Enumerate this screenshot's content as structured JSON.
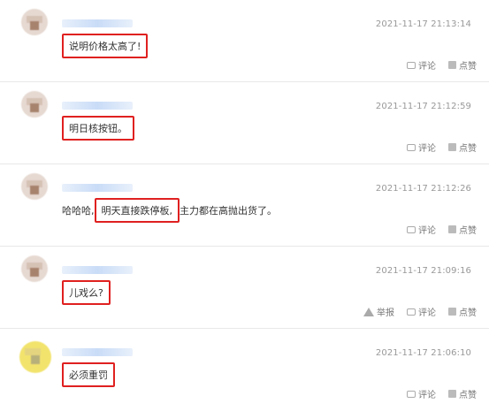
{
  "comments": [
    {
      "timestamp": "2021-11-17 21:13:14",
      "text_before": "",
      "highlight": "说明价格太高了!",
      "text_after": "",
      "comment_label": "评论",
      "like_label": "点赞"
    },
    {
      "timestamp": "2021-11-17 21:12:59",
      "text_before": "",
      "highlight": "明日核按钮。",
      "text_after": "",
      "comment_label": "评论",
      "like_label": "点赞"
    },
    {
      "timestamp": "2021-11-17 21:12:26",
      "text_before": "哈哈哈,",
      "highlight": "明天直接跌停板,",
      "text_after": "主力都在高抛出货了。",
      "comment_label": "评论",
      "like_label": "点赞"
    },
    {
      "timestamp": "2021-11-17 21:09:16",
      "text_before": "",
      "highlight": "儿戏么?",
      "text_after": "",
      "report_label": "举报",
      "comment_label": "评论",
      "like_label": "点赞"
    },
    {
      "timestamp": "2021-11-17 21:06:10",
      "text_before": "",
      "highlight": "必须重罚",
      "text_after": "",
      "comment_label": "评论",
      "like_label": "点赞"
    }
  ],
  "colors": {
    "highlight_border": "#e02020",
    "timestamp": "#999999",
    "divider": "#e8e8e8"
  }
}
